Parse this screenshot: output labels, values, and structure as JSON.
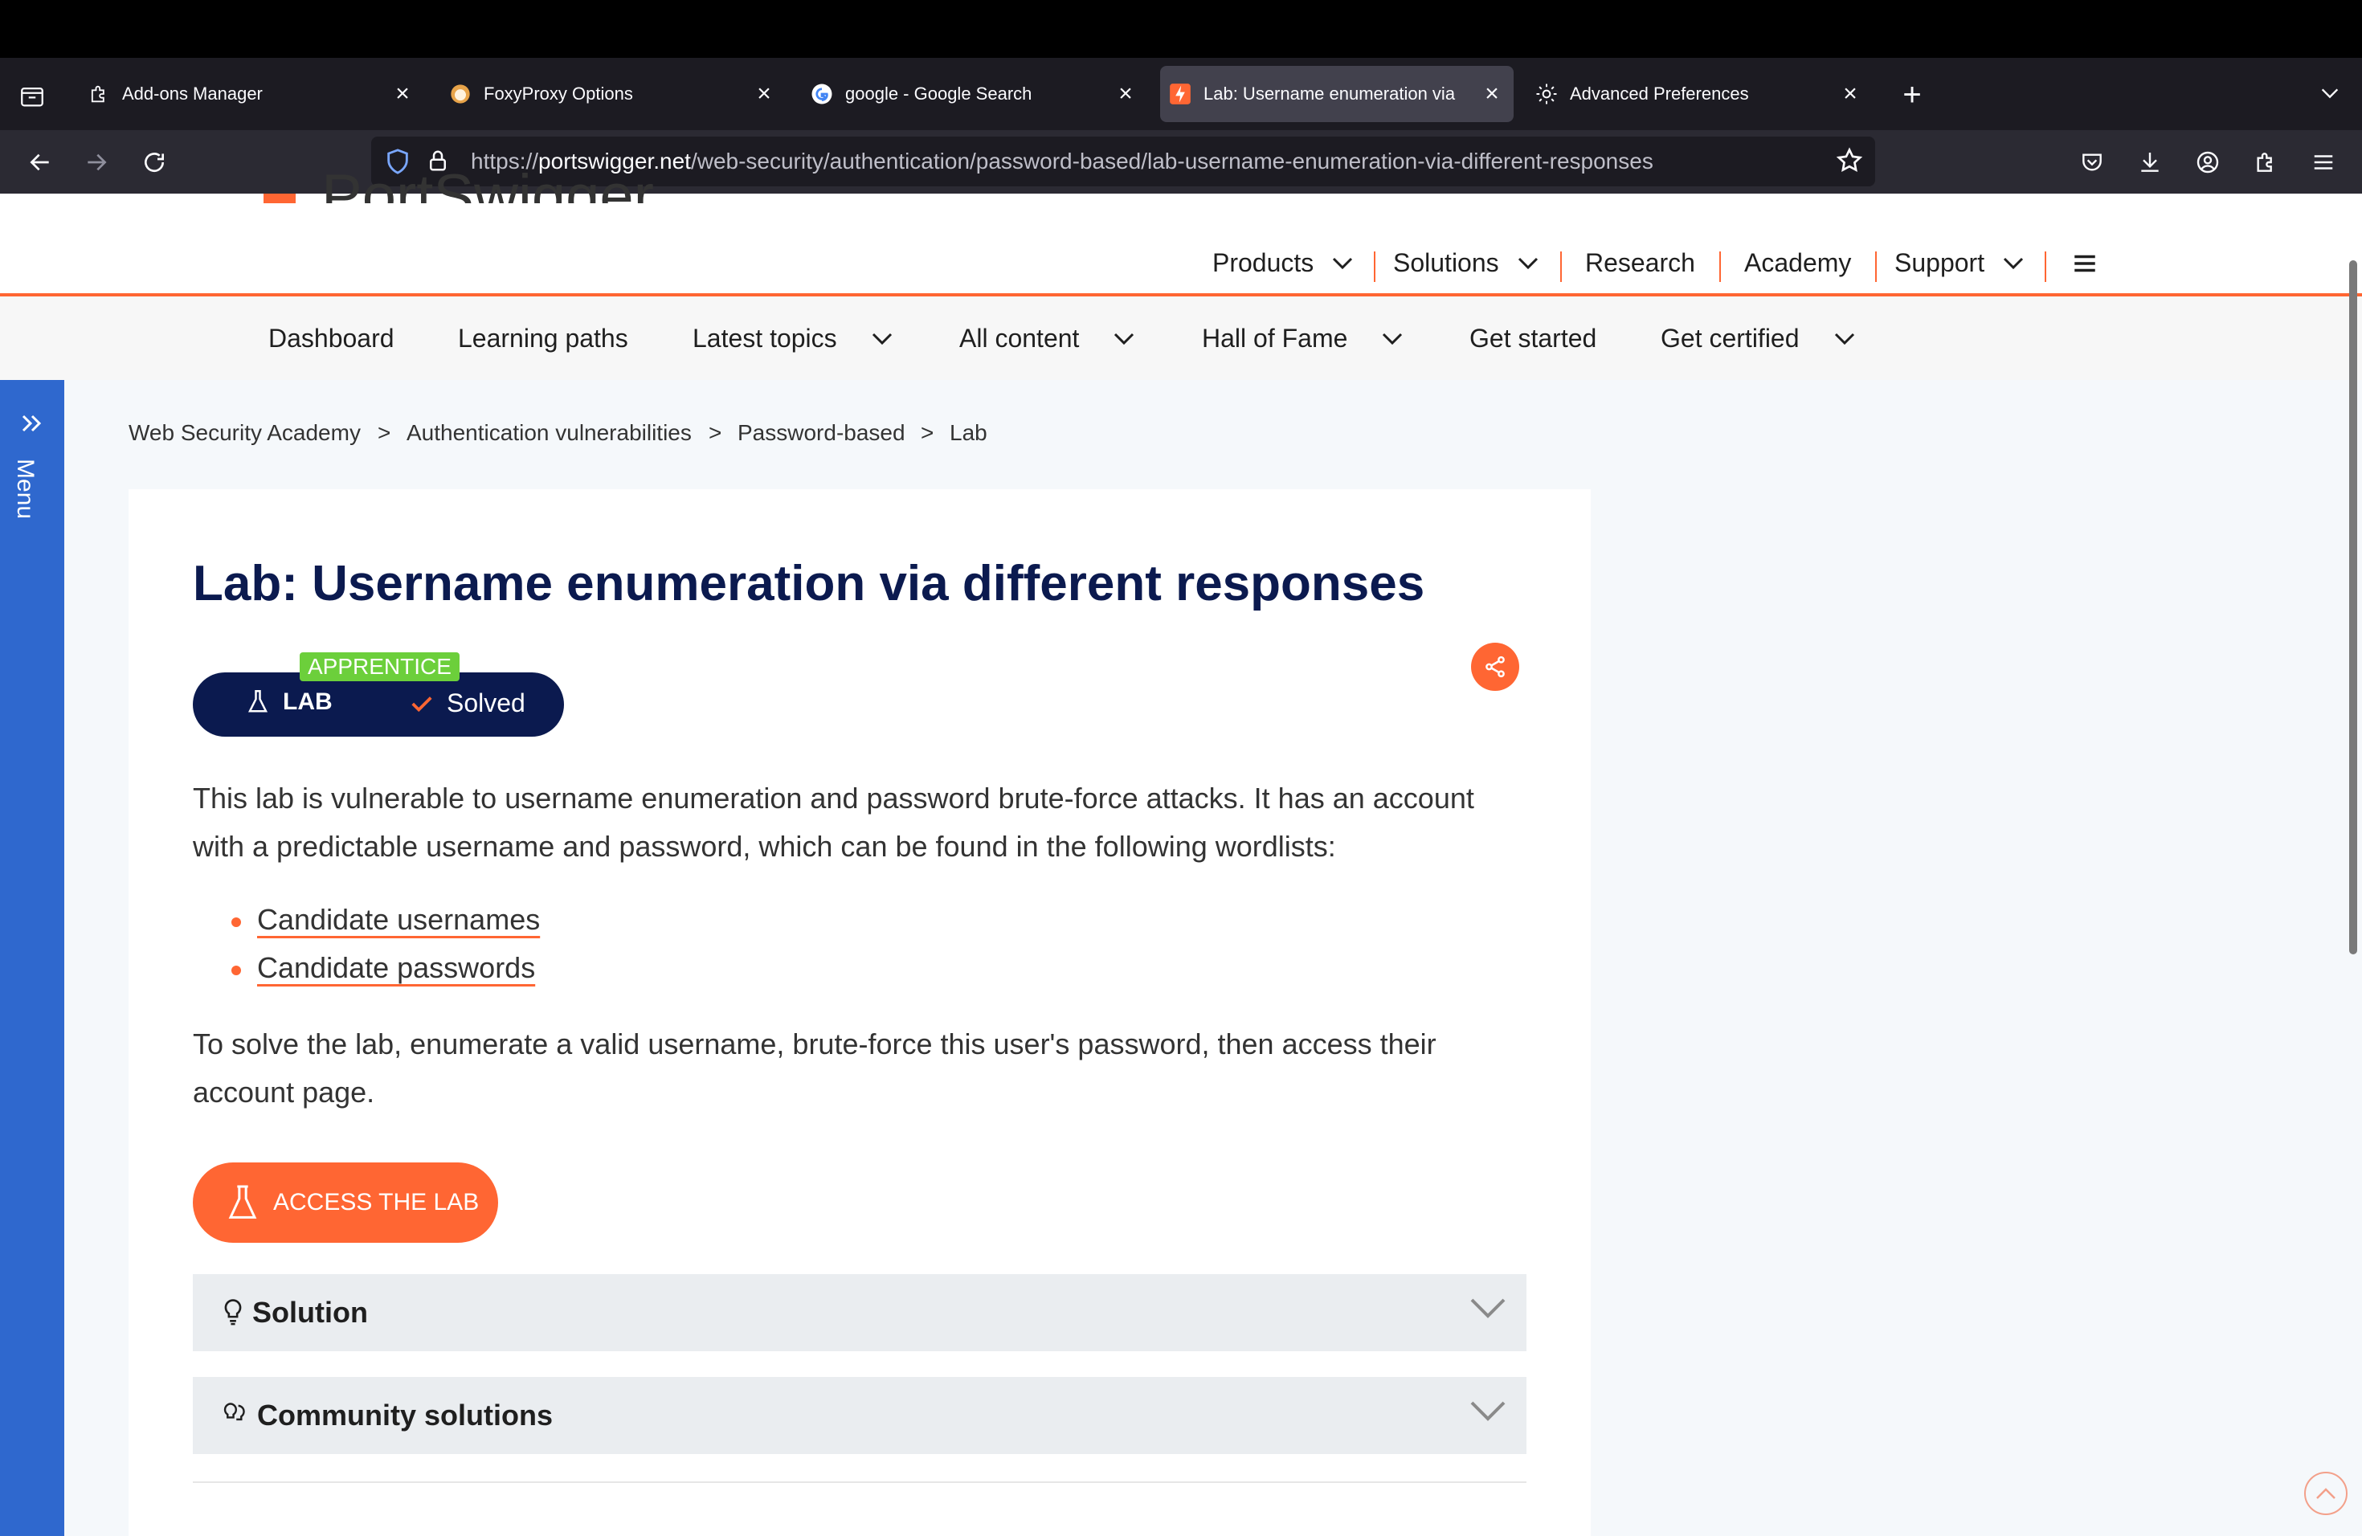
{
  "browser": {
    "tabs": [
      {
        "label": "Add-ons Manager",
        "icon": "puzzle-icon"
      },
      {
        "label": "FoxyProxy Options",
        "icon": "foxyproxy-icon"
      },
      {
        "label": "google - Google Search",
        "icon": "google-icon"
      },
      {
        "label": "Lab: Username enumeration via",
        "icon": "portswigger-icon"
      },
      {
        "label": "Advanced Preferences",
        "icon": "gear-icon"
      }
    ],
    "active_tab": 3,
    "url_domain": "portswigger.net",
    "url_prefix": "https://",
    "url_path": "/web-security/authentication/password-based/lab-username-enumeration-via-different-responses"
  },
  "site": {
    "brand_partial": "PortSwigger",
    "top_nav": [
      "Products",
      "Solutions",
      "Research",
      "Academy",
      "Support"
    ],
    "sub_nav": [
      "Dashboard",
      "Learning paths",
      "Latest topics",
      "All content",
      "Hall of Fame",
      "Get started",
      "Get certified"
    ],
    "sidebar_label": "Menu"
  },
  "breadcrumb": [
    "Web Security Academy",
    "Authentication vulnerabilities",
    "Password-based",
    "Lab"
  ],
  "lab": {
    "title": "Lab: Username enumeration via different responses",
    "level": "APPRENTICE",
    "lab_label": "LAB",
    "status": "Solved",
    "intro": "This lab is vulnerable to username enumeration and password brute-force attacks. It has an account with a predictable username and password, which can be found in the following wordlists:",
    "links": [
      "Candidate usernames",
      "Candidate passwords"
    ],
    "goal": "To solve the lab, enumerate a valid username, brute-force this user's password, then access their account page.",
    "access_button": "ACCESS THE LAB",
    "sections": [
      "Solution",
      "Community solutions"
    ]
  },
  "colors": {
    "accent": "#ff6633",
    "navy": "#0b1a4f",
    "sidebar": "#2f68ce",
    "badge": "#6ccf3b"
  }
}
